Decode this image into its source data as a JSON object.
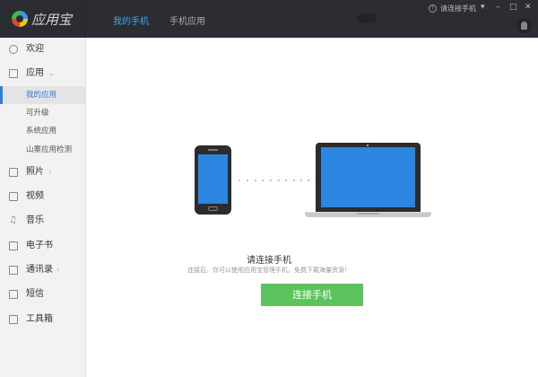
{
  "app": {
    "name": "应用宝"
  },
  "tabs": [
    {
      "label": "我的手机"
    },
    {
      "label": "手机应用"
    }
  ],
  "topbar": {
    "connect_status": "请连接手机",
    "menu": "▾",
    "minimize": "–",
    "maximize": "□",
    "close": "✕",
    "help": "?"
  },
  "sidebar": {
    "welcome": "欢迎",
    "apps": "应用",
    "apps_sub": [
      "我的应用",
      "可升级",
      "系统应用",
      "山寨应用检测"
    ],
    "photos": "照片",
    "videos": "视频",
    "music": "音乐",
    "ebooks": "电子书",
    "contacts": "通讯录",
    "sms": "短信",
    "toolbox": "工具箱"
  },
  "main": {
    "title": "请连接手机",
    "description": "连接后，你可以使用应用宝管理手机，免费下载海量资源！",
    "connect_button": "连接手机"
  },
  "colors": {
    "accent": "#2f7fd8",
    "button": "#5cc35c",
    "header": "#2b2d33"
  }
}
